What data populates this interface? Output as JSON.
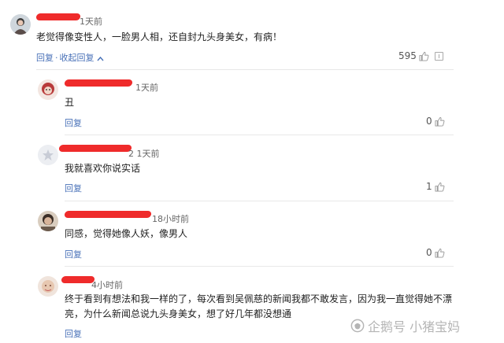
{
  "comments": [
    {
      "time": "1天前",
      "text": "老觉得像变性人，一脸男人相，还自封九头身美女，有病！",
      "reply": "回复",
      "collapse": "收起回复",
      "likes": "595"
    },
    {
      "time": "1天前",
      "text": "丑",
      "reply": "回复",
      "likes": "0"
    },
    {
      "time": "2 1天前",
      "text": "我就喜欢你说实话",
      "reply": "回复",
      "likes": "1"
    },
    {
      "time": "18小时前",
      "text": "同感，觉得她像人妖，像男人",
      "reply": "回复",
      "likes": "0"
    },
    {
      "time": "4小时前",
      "text_line1": "终于看到有想法和我一样的了，每次看到吴佩慈的新闻我都不敢发言，因为我一直觉得她不漂",
      "text_line2": "亮，为什么新闻总说九头身美女，想了好几年都没想通",
      "reply": "回复"
    }
  ],
  "watermark": "企鹅号 小猪宝妈"
}
